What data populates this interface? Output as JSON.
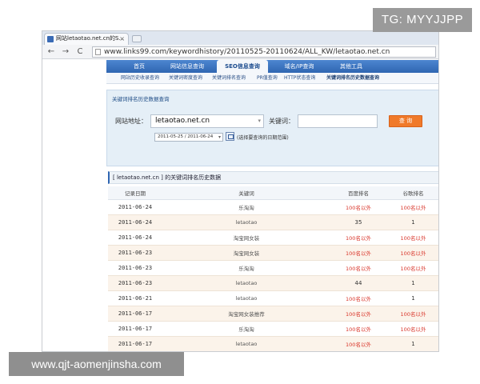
{
  "watermarks": {
    "top": "TG: MYYJJPP",
    "bottom": "www.qjt-aomenjinsha.com"
  },
  "browser": {
    "tab_title": "网站letaotao.net.cn的S...",
    "tab_close": "×",
    "address": "www.links99.com/keywordhistory/20110525-20110624/ALL_KW/letaotao.net.cn",
    "nav_back": "←",
    "nav_forward": "→",
    "nav_reload": "C"
  },
  "site_nav": {
    "items": [
      "首页",
      "网站信息查询",
      "SEO信息查询",
      "域名/IP查询",
      "其他工具"
    ],
    "active": "SEO信息查询"
  },
  "sub_nav": {
    "items": [
      "网站历史收录查询",
      "关键词密度查询",
      "关键词排名查询",
      "PR值查询",
      "HTTP状态查询",
      "关键词排名历史数据查询"
    ]
  },
  "search_panel": {
    "title": "关键词排名历史数据查询",
    "site_label": "网站地址：",
    "site_value": "letaotao.net.cn",
    "keyword_label": "关键词：",
    "keyword_value": "",
    "query_button": "查 询",
    "date_range": "2011-05-25 / 2011-06-24",
    "date_hint": "(选择要查询的日期范围)"
  },
  "results": {
    "title": "[ letaotao.net.cn ] 的关键词排名历史数据",
    "columns": [
      "记录日期",
      "关键词",
      "百度排名",
      "谷歌排名"
    ],
    "rows": [
      {
        "date": "2011-06-24",
        "keyword": "乐淘淘",
        "baidu": "100名以外",
        "google": "100名以外"
      },
      {
        "date": "2011-06-24",
        "keyword": "letaotao",
        "baidu": "35",
        "google": "1"
      },
      {
        "date": "2011-06-24",
        "keyword": "淘宝网女装",
        "baidu": "100名以外",
        "google": "100名以外"
      },
      {
        "date": "2011-06-23",
        "keyword": "淘宝网女装",
        "baidu": "100名以外",
        "google": "100名以外"
      },
      {
        "date": "2011-06-23",
        "keyword": "乐淘淘",
        "baidu": "100名以外",
        "google": "100名以外"
      },
      {
        "date": "2011-06-23",
        "keyword": "letaotao",
        "baidu": "44",
        "google": "1"
      },
      {
        "date": "2011-06-21",
        "keyword": "letaotao",
        "baidu": "100名以外",
        "google": "1"
      },
      {
        "date": "2011-06-17",
        "keyword": "淘宝网女装推荐",
        "baidu": "100名以外",
        "google": "100名以外"
      },
      {
        "date": "2011-06-17",
        "keyword": "乐淘淘",
        "baidu": "100名以外",
        "google": "100名以外"
      },
      {
        "date": "2011-06-17",
        "keyword": "letaotao",
        "baidu": "100名以外",
        "google": "1"
      }
    ]
  },
  "colors": {
    "nav_blue": "#2f66b2",
    "query_orange": "#f07a2a",
    "rank_red": "#d9352a",
    "panel_bg": "#e5eff7"
  }
}
